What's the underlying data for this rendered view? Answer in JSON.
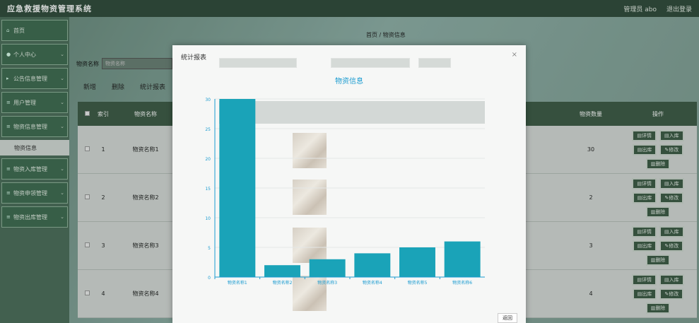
{
  "header": {
    "app_title": "应急救援物资管理系统",
    "user_label": "管理员 abo",
    "logout_label": "退出登录"
  },
  "sidebar": {
    "items": [
      {
        "label": "首页",
        "has_chevron": false
      },
      {
        "label": "个人中心",
        "has_chevron": true
      },
      {
        "label": "公告信息管理",
        "has_chevron": true
      },
      {
        "label": "用户管理",
        "has_chevron": true
      },
      {
        "label": "物资信息管理",
        "has_chevron": true
      }
    ],
    "sub_item": "物资信息",
    "items_after": [
      {
        "label": "物资入库管理",
        "has_chevron": true
      },
      {
        "label": "物资申领管理",
        "has_chevron": true
      },
      {
        "label": "物资出库管理",
        "has_chevron": true
      }
    ]
  },
  "breadcrumb": {
    "home": "首页",
    "sep": "/",
    "current": "物资信息"
  },
  "search": {
    "label": "物资名称",
    "placeholder": "物资名称"
  },
  "actions": {
    "add": "新增",
    "delete": "删除",
    "report": "统计报表"
  },
  "table": {
    "headers": {
      "index": "索引",
      "name": "物资名称",
      "qty": "物资数量",
      "ops": "操作"
    },
    "rows": [
      {
        "index": "1",
        "name": "物资名称1",
        "qty": "30"
      },
      {
        "index": "2",
        "name": "物资名称2",
        "qty": "2"
      },
      {
        "index": "3",
        "name": "物资名称3",
        "qty": "3"
      },
      {
        "index": "4",
        "name": "物资名称4",
        "qty": "4"
      }
    ],
    "op_labels": {
      "detail": "详情",
      "in": "入库",
      "out": "出库",
      "edit": "修改",
      "delete": "删除"
    }
  },
  "modal": {
    "title": "统计报表",
    "close": "×",
    "back_label": "返回"
  },
  "chart_data": {
    "type": "bar",
    "title": "物资信息",
    "categories": [
      "物资名称1",
      "物资名称2",
      "物资名称3",
      "物资名称4",
      "物资名称5",
      "物资名称6"
    ],
    "values": [
      30,
      2,
      3,
      4,
      5,
      6
    ],
    "ylim": [
      0,
      30
    ],
    "yticks": [
      0,
      5,
      10,
      15,
      20,
      25,
      30
    ],
    "color": "#1aa3b8"
  }
}
